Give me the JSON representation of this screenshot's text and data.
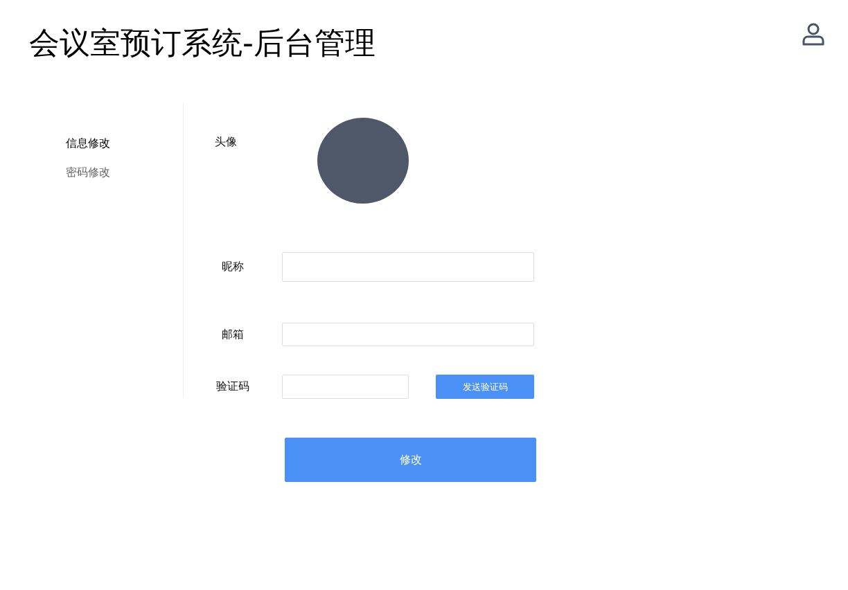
{
  "header": {
    "title": "会议室预订系统-后台管理"
  },
  "sidebar": {
    "items": [
      {
        "label": "信息修改",
        "selected": true
      },
      {
        "label": "密码修改",
        "selected": false
      }
    ]
  },
  "form": {
    "avatar_label": "头像",
    "fields": [
      {
        "kind": "text",
        "label": "昵称"
      },
      {
        "kind": "text",
        "label": "邮箱"
      },
      {
        "kind": "code",
        "label": "验证码",
        "button": "发送验证码"
      }
    ],
    "submit": "修改"
  }
}
